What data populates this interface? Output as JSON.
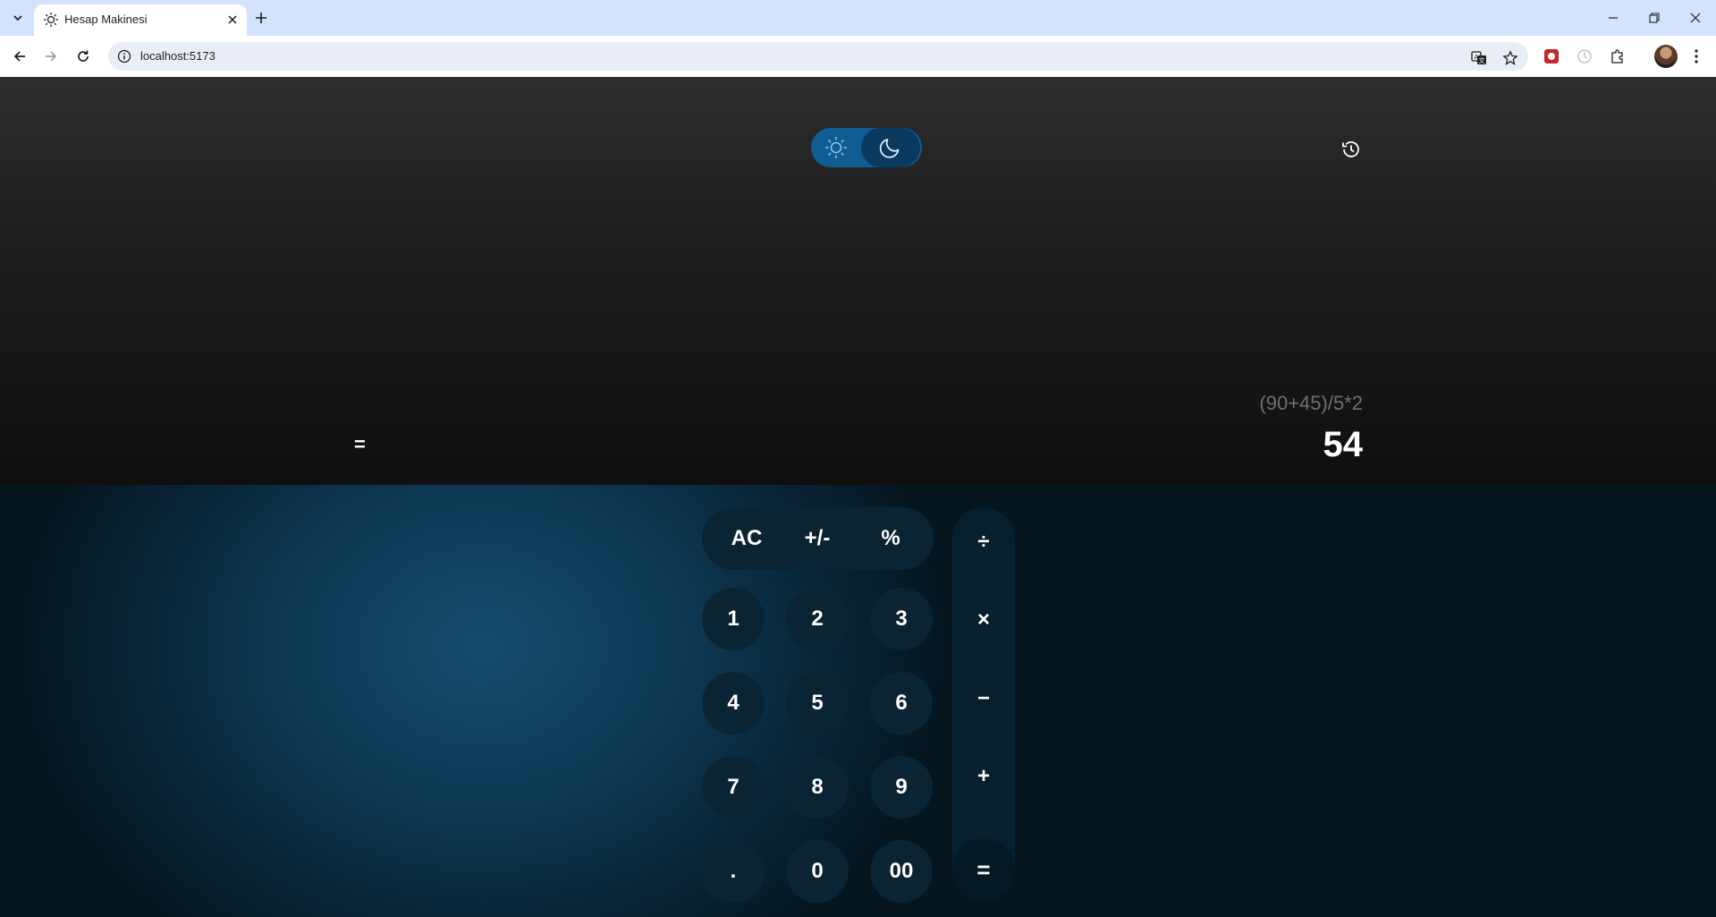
{
  "browser": {
    "tab_title": "Hesap Makinesi",
    "url": "localhost:5173",
    "icons": {
      "tab_list": "chevron-down-icon",
      "favicon": "sun-icon",
      "tab_close": "close-icon",
      "new_tab": "plus-icon",
      "minimize": "minimize-icon",
      "restore": "restore-icon",
      "close_window": "close-icon",
      "back": "arrow-left-icon",
      "forward": "arrow-right-icon",
      "reload": "reload-icon",
      "site_info": "info-icon",
      "translate": "translate-icon",
      "bookmark": "star-icon",
      "extensions": "puzzle-icon",
      "menu": "more-vert-icon"
    }
  },
  "app": {
    "theme_toggle": {
      "light_icon": "sun-icon",
      "dark_icon": "moon-icon",
      "active": "dark"
    },
    "history_icon": "history-icon",
    "display": {
      "equals_sign": "=",
      "expression": "(90+45)/5*2",
      "result": "54"
    },
    "keypad": {
      "function_keys": [
        "AC",
        "+/-",
        "%"
      ],
      "digit_rows": [
        [
          "1",
          "2",
          "3"
        ],
        [
          "4",
          "5",
          "6"
        ],
        [
          "7",
          "8",
          "9"
        ],
        [
          ".",
          "0",
          "00"
        ]
      ],
      "operators": [
        "÷",
        "×",
        "−",
        "+"
      ],
      "equals": "="
    },
    "colors": {
      "toggle_bg": "#0f5d93",
      "toggle_active": "#0a3a60",
      "key_bg": "#0b2433",
      "expression_text": "#6f6f72",
      "result_text": "#ffffff"
    }
  }
}
